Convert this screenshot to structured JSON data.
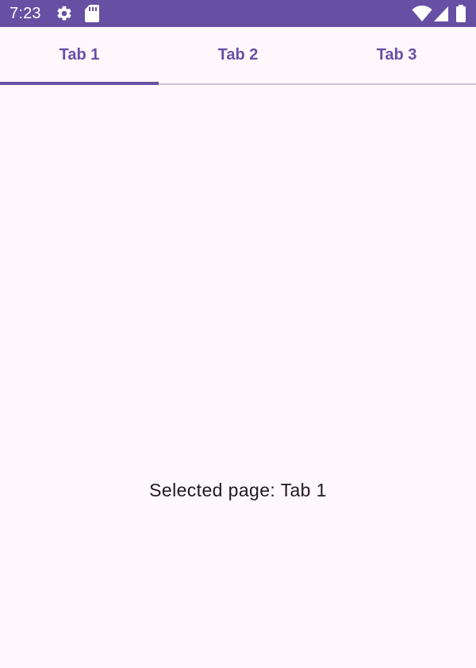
{
  "status_bar": {
    "time": "7:23",
    "background_color": "#6750A4",
    "icons_left": [
      "settings-gear-icon",
      "sd-card-icon"
    ],
    "icons_right": [
      "wifi-icon",
      "cell-signal-icon",
      "battery-icon"
    ]
  },
  "tabs": {
    "items": [
      {
        "label": "Tab 1",
        "selected": true
      },
      {
        "label": "Tab 2",
        "selected": false
      },
      {
        "label": "Tab 3",
        "selected": false
      }
    ],
    "accent_color": "#6750A4"
  },
  "content": {
    "selected_text": "Selected page: Tab 1"
  }
}
